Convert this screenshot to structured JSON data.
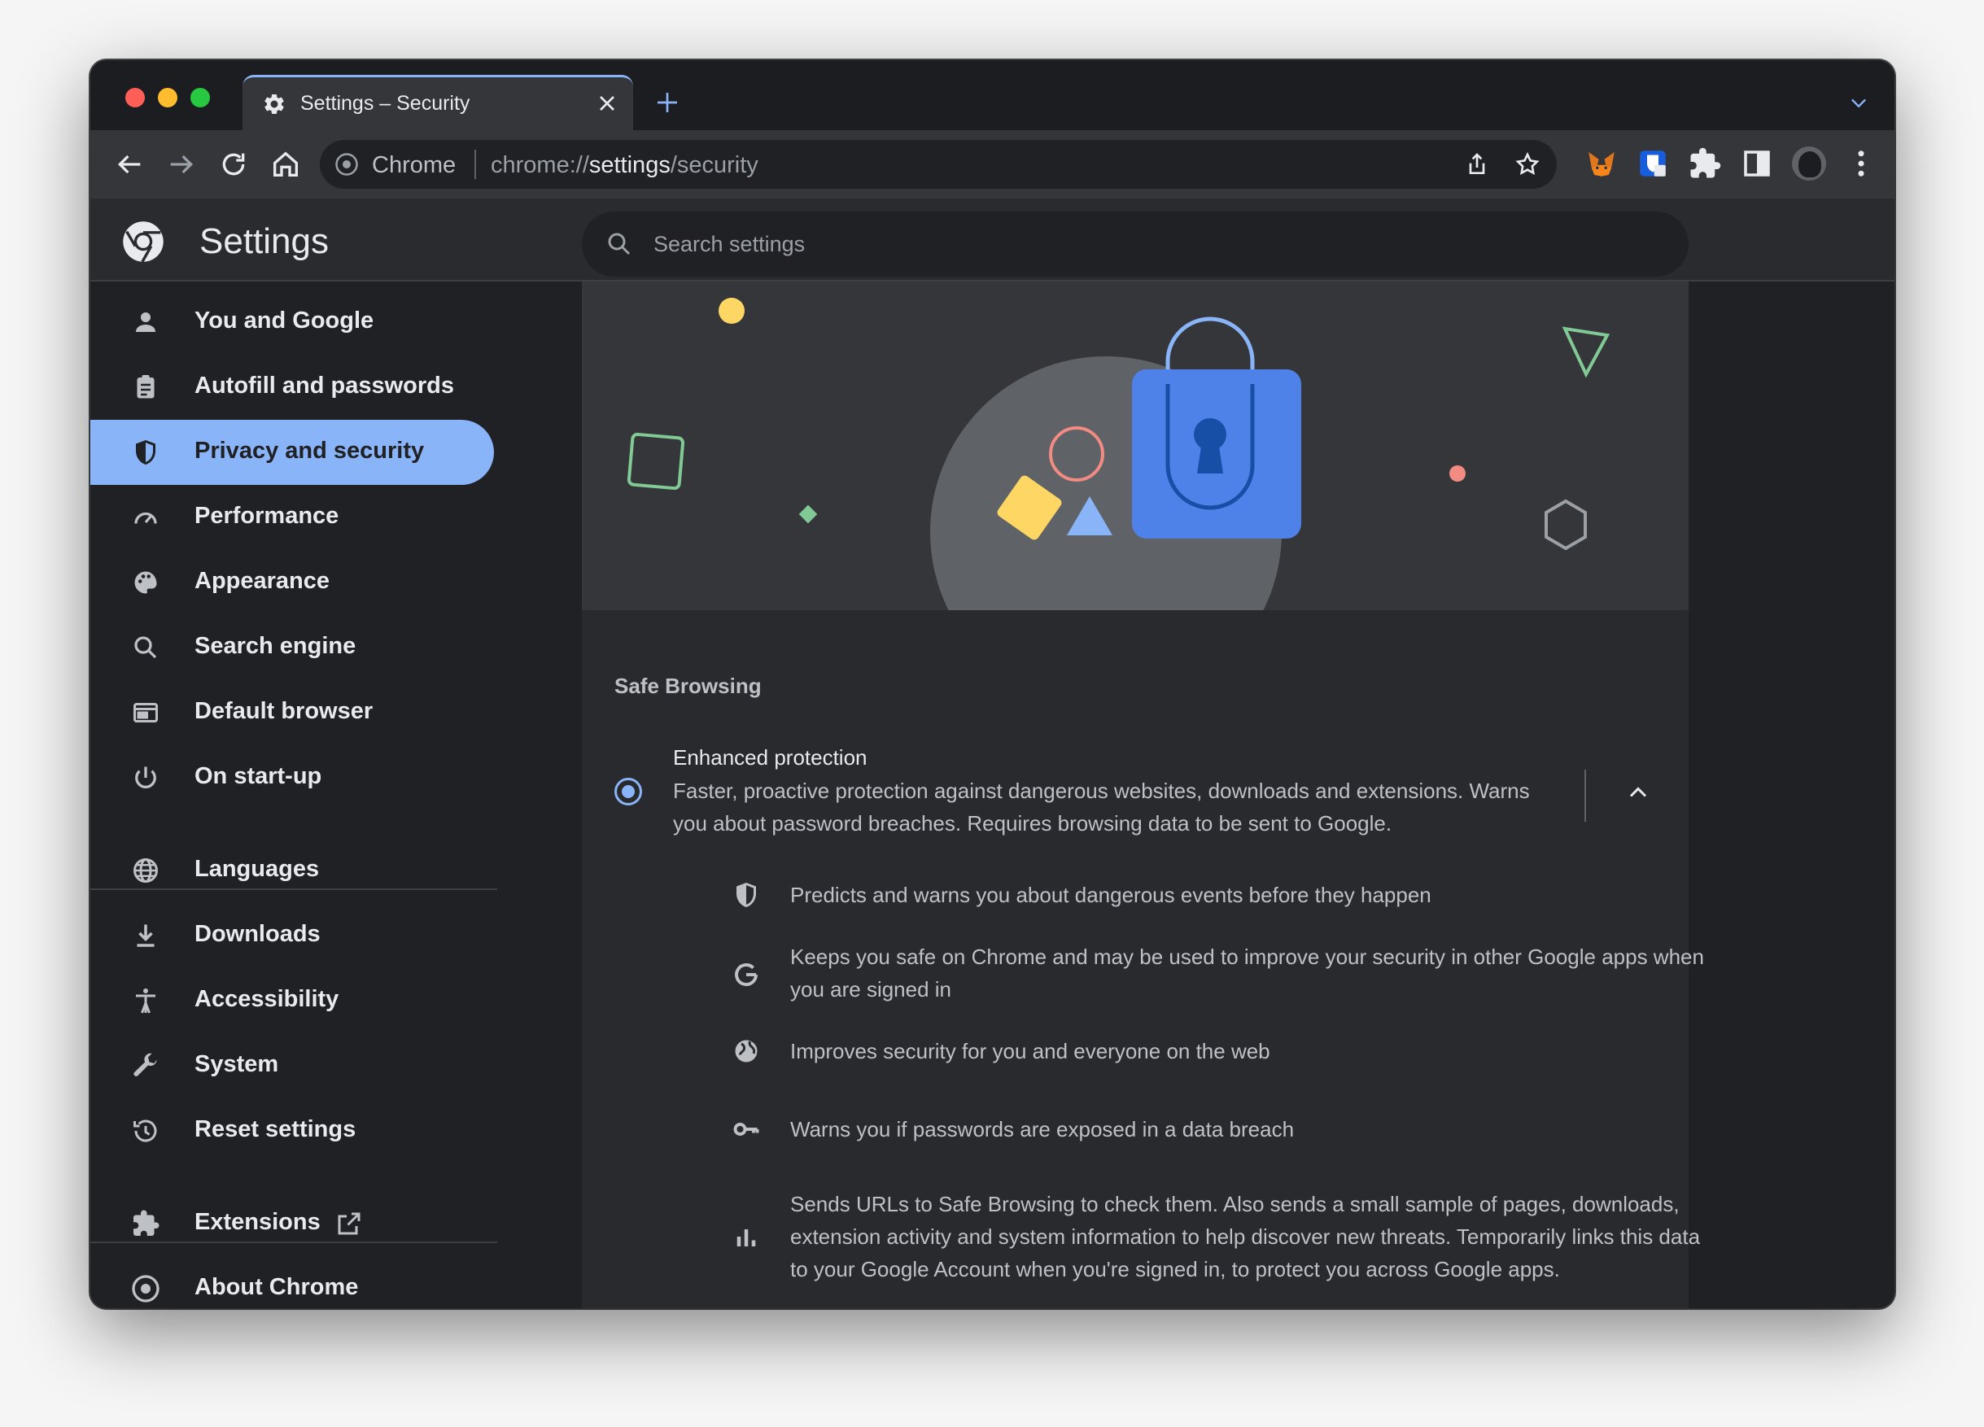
{
  "tab": {
    "title": "Settings – Security"
  },
  "omnibox": {
    "site_name": "Chrome",
    "url_prefix": "chrome://",
    "url_host": "settings",
    "url_path": "/security"
  },
  "header": {
    "title": "Settings",
    "search_placeholder": "Search settings"
  },
  "sidebar": {
    "items": [
      {
        "label": "You and Google",
        "icon": "person-icon"
      },
      {
        "label": "Autofill and passwords",
        "icon": "clipboard-icon"
      },
      {
        "label": "Privacy and security",
        "icon": "shield-icon",
        "active": true
      },
      {
        "label": "Performance",
        "icon": "speedometer-icon"
      },
      {
        "label": "Appearance",
        "icon": "palette-icon"
      },
      {
        "label": "Search engine",
        "icon": "search-icon"
      },
      {
        "label": "Default browser",
        "icon": "browser-icon"
      },
      {
        "label": "On start-up",
        "icon": "power-icon"
      },
      {
        "label": "Languages",
        "icon": "globe-icon"
      },
      {
        "label": "Downloads",
        "icon": "download-icon"
      },
      {
        "label": "Accessibility",
        "icon": "accessibility-icon"
      },
      {
        "label": "System",
        "icon": "wrench-icon"
      },
      {
        "label": "Reset settings",
        "icon": "history-icon"
      },
      {
        "label": "Extensions",
        "icon": "puzzle-icon"
      },
      {
        "label": "About Chrome",
        "icon": "chrome-icon"
      }
    ]
  },
  "main": {
    "section_title": "Safe Browsing",
    "option": {
      "title": "Enhanced protection",
      "description": "Faster, proactive protection against dangerous websites, downloads and extensions. Warns you about password breaches. Requires browsing data to be sent to Google.",
      "selected": true
    },
    "features": [
      {
        "icon": "shield-icon",
        "text": "Predicts and warns you about dangerous events before they happen"
      },
      {
        "icon": "google-g-icon",
        "text": "Keeps you safe on Chrome and may be used to improve your security in other Google apps when you are signed in"
      },
      {
        "icon": "globe-icon",
        "text": "Improves security for you and everyone on the web"
      },
      {
        "icon": "key-icon",
        "text": "Warns you if passwords are exposed in a data breach"
      },
      {
        "icon": "bar-chart-icon",
        "text": "Sends URLs to Safe Browsing to check them. Also sends a small sample of pages, downloads, extension activity and system information to help discover new threats. Temporarily links this data to your Google Account when you're signed in, to protect you across Google apps."
      }
    ]
  },
  "colors": {
    "accent": "#8ab4f8",
    "background": "#202124",
    "surface": "#292a2d",
    "text": "#e8eaed",
    "subtext": "#bdc1c6"
  }
}
